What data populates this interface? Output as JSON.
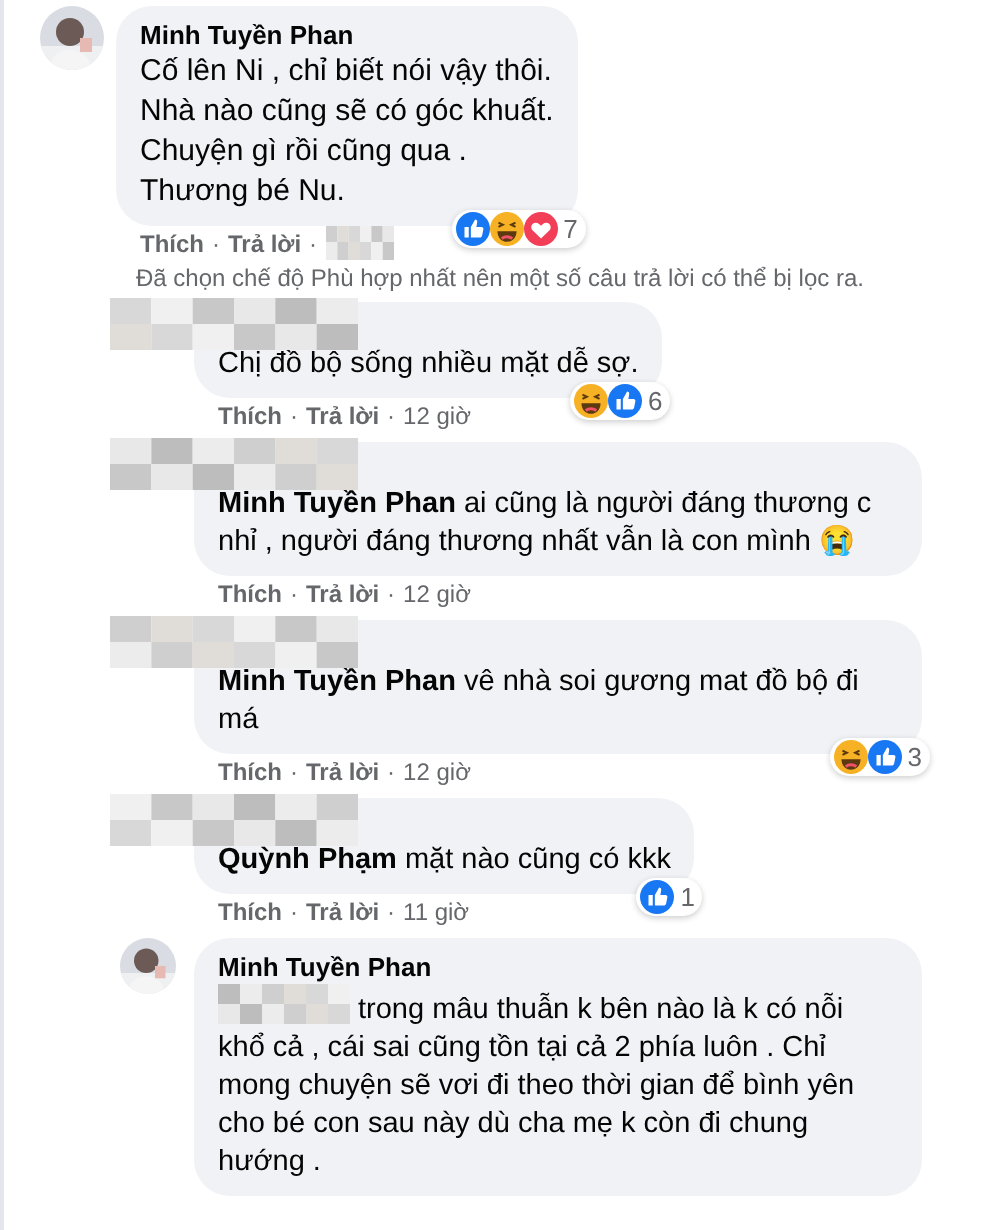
{
  "comment": {
    "author": "Minh Tuyền Phan",
    "lines": [
      "Cố lên Ni , chỉ biết nói vậy thôi.",
      "Nhà nào cũng sẽ có góc khuất.",
      "Chuyện gì rồi cũng qua .",
      "Thương bé Nu."
    ],
    "reactions": [
      {
        "kind": "like"
      },
      {
        "kind": "haha"
      },
      {
        "kind": "love"
      }
    ],
    "reaction_count": "7",
    "like": "Thích",
    "separator": "·",
    "reply": "Trả lời",
    "time_blurred": true,
    "note": "Đã chọn chế độ Phù hợp nhất nên một số câu trả lời có thể bị lọc ra.",
    "replies": [
      {
        "author_blurred": true,
        "text": "Chị đồ bộ sống nhiều mặt dễ sợ.",
        "reactions": [
          {
            "kind": "haha"
          },
          {
            "kind": "like"
          }
        ],
        "reaction_count": "6",
        "like": "Thích",
        "separator": "·",
        "reply": "Trả lời",
        "time": "12 giờ"
      },
      {
        "author_blurred": true,
        "text": "**Minh Tuyền Phan** ai cũng là người đáng thương c nhỉ , người đáng thương nhất vẫn là con mình 😭",
        "like": "Thích",
        "separator": "·",
        "reply": "Trả lời",
        "time": "12 giờ"
      },
      {
        "author_blurred": true,
        "text": "**Minh Tuyền Phan** vê nhà soi gương mat đồ bộ đi má",
        "reactions": [
          {
            "kind": "haha"
          },
          {
            "kind": "like"
          }
        ],
        "reaction_count": "3",
        "like": "Thích",
        "separator": "·",
        "reply": "Trả lời",
        "time": "12 giờ"
      },
      {
        "author_blurred": true,
        "text": "**Quỳnh Phạm** mặt nào cũng có kkk",
        "reactions": [
          {
            "kind": "like"
          }
        ],
        "reaction_count": "1",
        "like": "Thích",
        "separator": "·",
        "reply": "Trả lời",
        "time": "11 giờ"
      },
      {
        "author": "Minh Tuyền Phan",
        "prefix_blurred": true,
        "text": "trong mâu thuẫn k bên nào là k có nỗi khổ cả , cái sai cũng tồn tại cả 2 phía luôn . Chỉ mong chuyện sẽ vơi đi theo thời gian để bình yên cho bé con sau này dù cha mẹ k còn đi chung hướng ."
      }
    ]
  }
}
